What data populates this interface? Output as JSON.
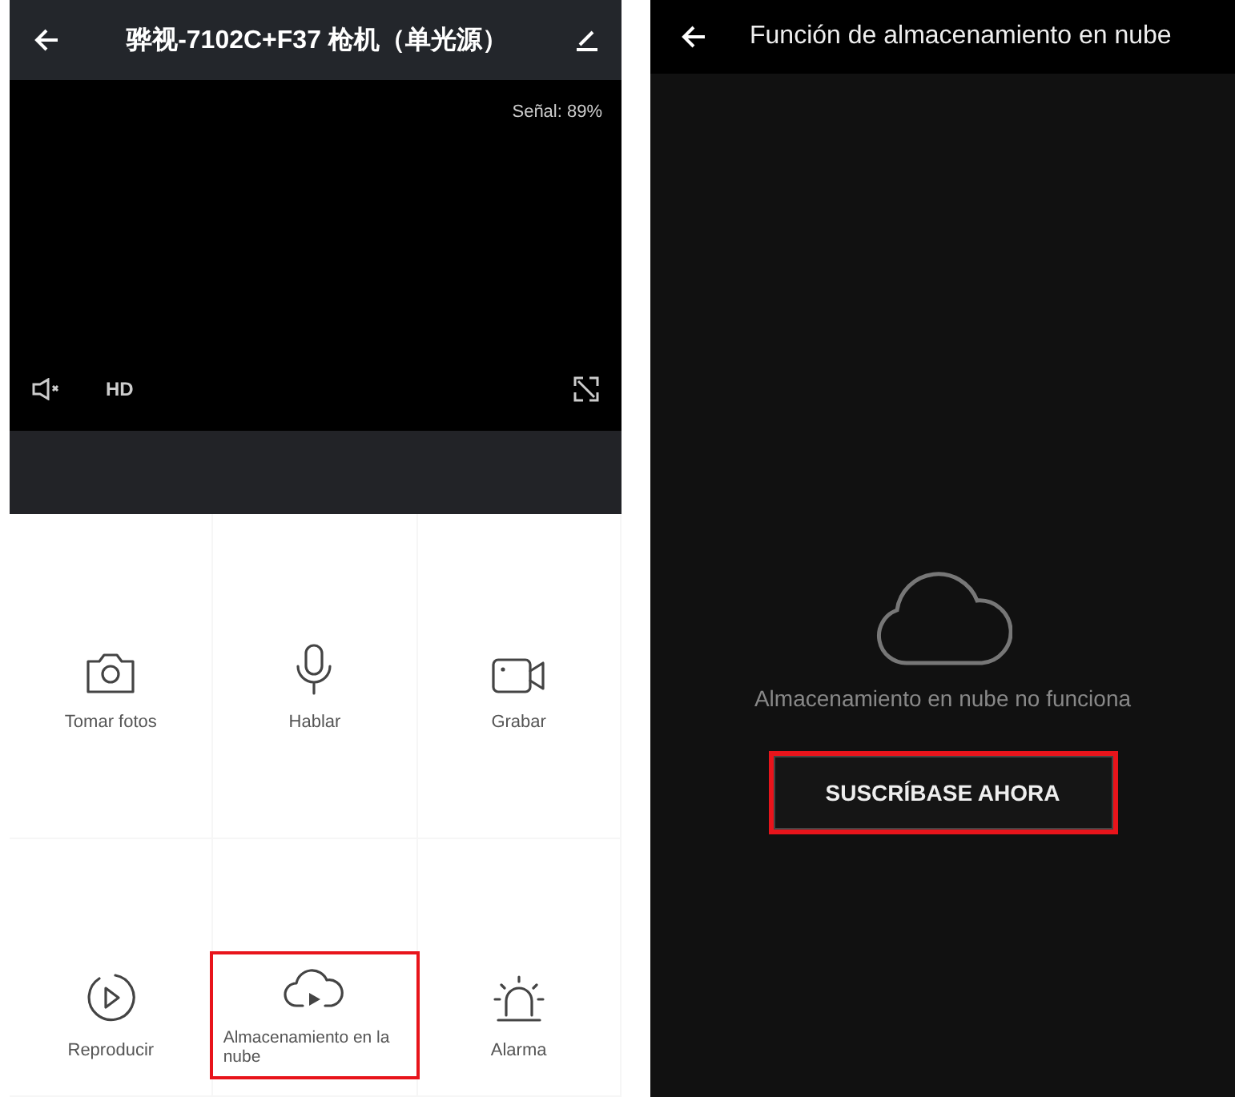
{
  "camera_screen": {
    "title": "骅视-7102C+F37 枪机（单光源）",
    "signal": "Señal: 89%",
    "quality": "HD",
    "actions": [
      {
        "kind": "camera",
        "label": "Tomar fotos",
        "highlighted": false
      },
      {
        "kind": "mic",
        "label": "Hablar",
        "highlighted": false
      },
      {
        "kind": "video",
        "label": "Grabar",
        "highlighted": false
      },
      {
        "kind": "replay",
        "label": "Reproducir",
        "highlighted": false
      },
      {
        "kind": "cloud",
        "label": "Almacenamiento en la nube",
        "highlighted": true
      },
      {
        "kind": "alarm",
        "label": "Alarma",
        "highlighted": false
      }
    ]
  },
  "cloud_screen": {
    "title": "Función de almacenamiento en nube",
    "message": "Almacenamiento en nube no funciona",
    "button": {
      "label": "SUSCRÍBASE AHORA",
      "highlighted": true
    }
  }
}
